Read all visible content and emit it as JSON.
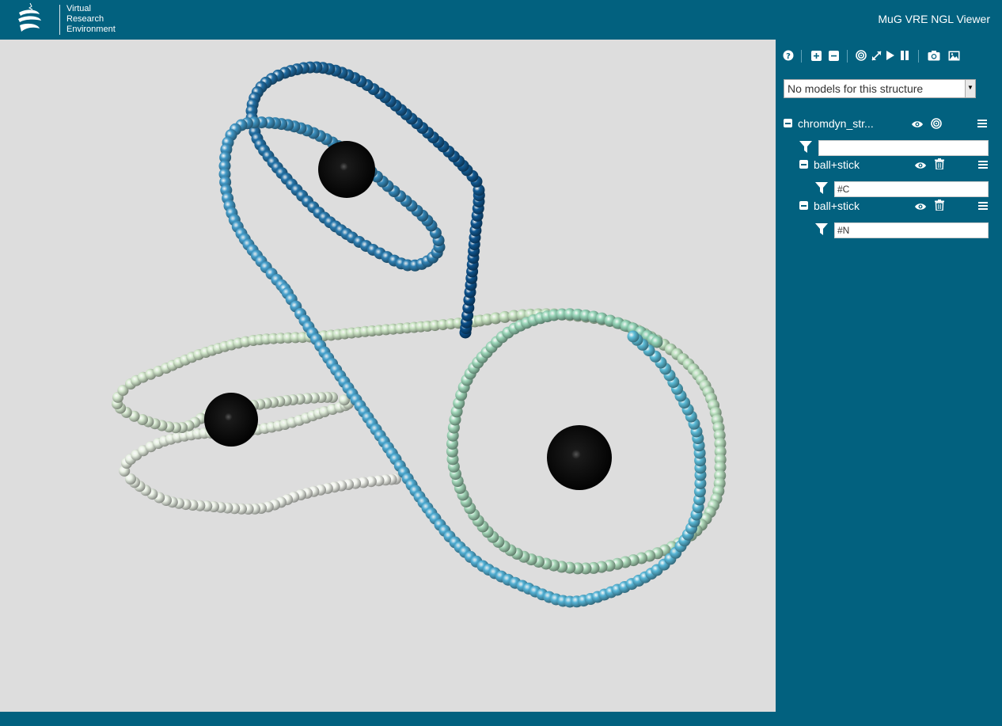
{
  "header": {
    "logo_lines": [
      "Virtual",
      "Research",
      "Environment"
    ],
    "app_title": "MuG VRE NGL Viewer"
  },
  "toolbar": {
    "icons": [
      "help-icon",
      "zoom-in-icon",
      "zoom-out-icon",
      "center-icon",
      "fullscreen-icon",
      "play-icon",
      "pause-icon",
      "screenshot-icon",
      "image-icon"
    ]
  },
  "models": {
    "selected": "No models for this structure"
  },
  "structure": {
    "name": "chromdyn_str...",
    "filter_value": "",
    "representations": [
      {
        "label": "ball+stick",
        "filter": "#C"
      },
      {
        "label": "ball+stick",
        "filter": "#N"
      }
    ]
  },
  "colors": {
    "header_bg": "#02617f",
    "viewer_bg": "#dddddd"
  }
}
